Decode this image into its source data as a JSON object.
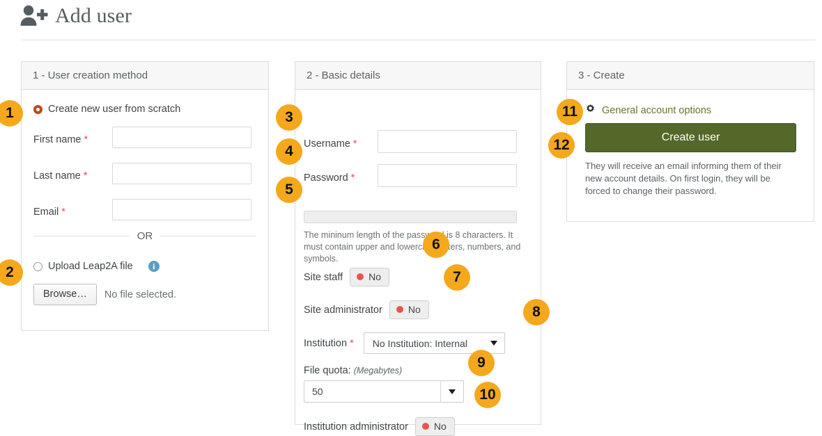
{
  "header": {
    "title": "Add user",
    "icon": "add-user-icon"
  },
  "panels": {
    "creation_method": {
      "title": "1 - User creation method",
      "option_scratch": {
        "label": "Create new user from scratch",
        "selected": true
      },
      "fields": [
        {
          "label": "First name",
          "required_marker": "*",
          "value": ""
        },
        {
          "label": "Last name",
          "required_marker": "*",
          "value": ""
        },
        {
          "label": "Email",
          "required_marker": "*",
          "value": ""
        }
      ],
      "divider_text": "OR",
      "option_upload": {
        "label": "Upload Leap2A file",
        "selected": false,
        "info_icon": "info-icon",
        "info_glyph": "i"
      },
      "browse_button": "Browse…",
      "file_status": "No file selected."
    },
    "basic_details": {
      "title": "2 - Basic details",
      "username": {
        "label": "Username",
        "required_marker": "*",
        "value": ""
      },
      "password": {
        "label": "Password",
        "required_marker": "*",
        "value": ""
      },
      "password_strength_meter": "",
      "password_hint": "The mininum length of the password is 8 characters. It must contain upper and lowercase letters, numbers, and symbols.",
      "site_staff": {
        "label": "Site staff",
        "value": "No"
      },
      "site_administrator": {
        "label": "Site administrator",
        "value": "No"
      },
      "institution": {
        "label": "Institution",
        "required_marker": "*",
        "value": "No Institution: Internal"
      },
      "file_quota": {
        "label": "File quota:",
        "units": "(Megabytes)",
        "value": "50"
      },
      "institution_administrator": {
        "label": "Institution administrator",
        "value": "No"
      }
    },
    "create": {
      "title": "3 - Create",
      "general_account_options": {
        "label": "General account options",
        "icon": "gear-icon"
      },
      "create_user_button": "Create user",
      "note": "They will receive an email informing them of their new account details. On first login, they will be forced to change their password."
    }
  },
  "badges": {
    "b1": "1",
    "b2": "2",
    "b3": "3",
    "b4": "4",
    "b5": "5",
    "b6": "6",
    "b7": "7",
    "b8": "8",
    "b9": "9",
    "b10": "10",
    "b11": "11",
    "b12": "12"
  },
  "colors": {
    "badge_background": "#f5a81c",
    "create_button": "#54682a",
    "radio_selected": "#bd4a18",
    "switch_off_dot": "#e8554e",
    "link_olive": "#68762f",
    "required_star": "#d9534f",
    "info_icon": "#5d9ec4"
  }
}
